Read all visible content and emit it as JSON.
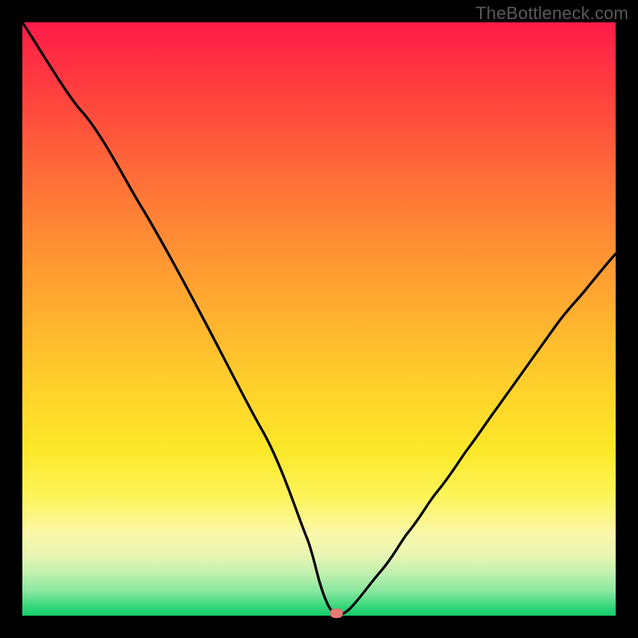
{
  "watermark": "TheBottleneck.com",
  "colors": {
    "background_outer": "#000000",
    "curve_stroke": "#000000",
    "marker_fill": "#e87b74",
    "gradient_top": "#ff1b48",
    "gradient_bottom": "#15cc69"
  },
  "chart_data": {
    "type": "line",
    "title": "",
    "xlabel": "",
    "ylabel": "",
    "xlim": [
      0,
      100
    ],
    "ylim": [
      0,
      100
    ],
    "grid": false,
    "series": [
      {
        "name": "bottleneck-curve",
        "x": [
          0,
          5,
          10,
          15,
          20,
          25,
          30,
          35,
          40,
          45,
          48,
          50,
          52,
          53,
          55,
          60,
          65,
          70,
          75,
          80,
          85,
          90,
          95,
          100
        ],
        "y": [
          100,
          93,
          85,
          77,
          69,
          60,
          51,
          42,
          32,
          21,
          13,
          6,
          1,
          0,
          1,
          7,
          14,
          21,
          28,
          35,
          42,
          49,
          55,
          61
        ]
      }
    ],
    "annotations": [
      {
        "name": "minimum-marker",
        "x": 53,
        "y": 0
      }
    ],
    "legend": false
  }
}
